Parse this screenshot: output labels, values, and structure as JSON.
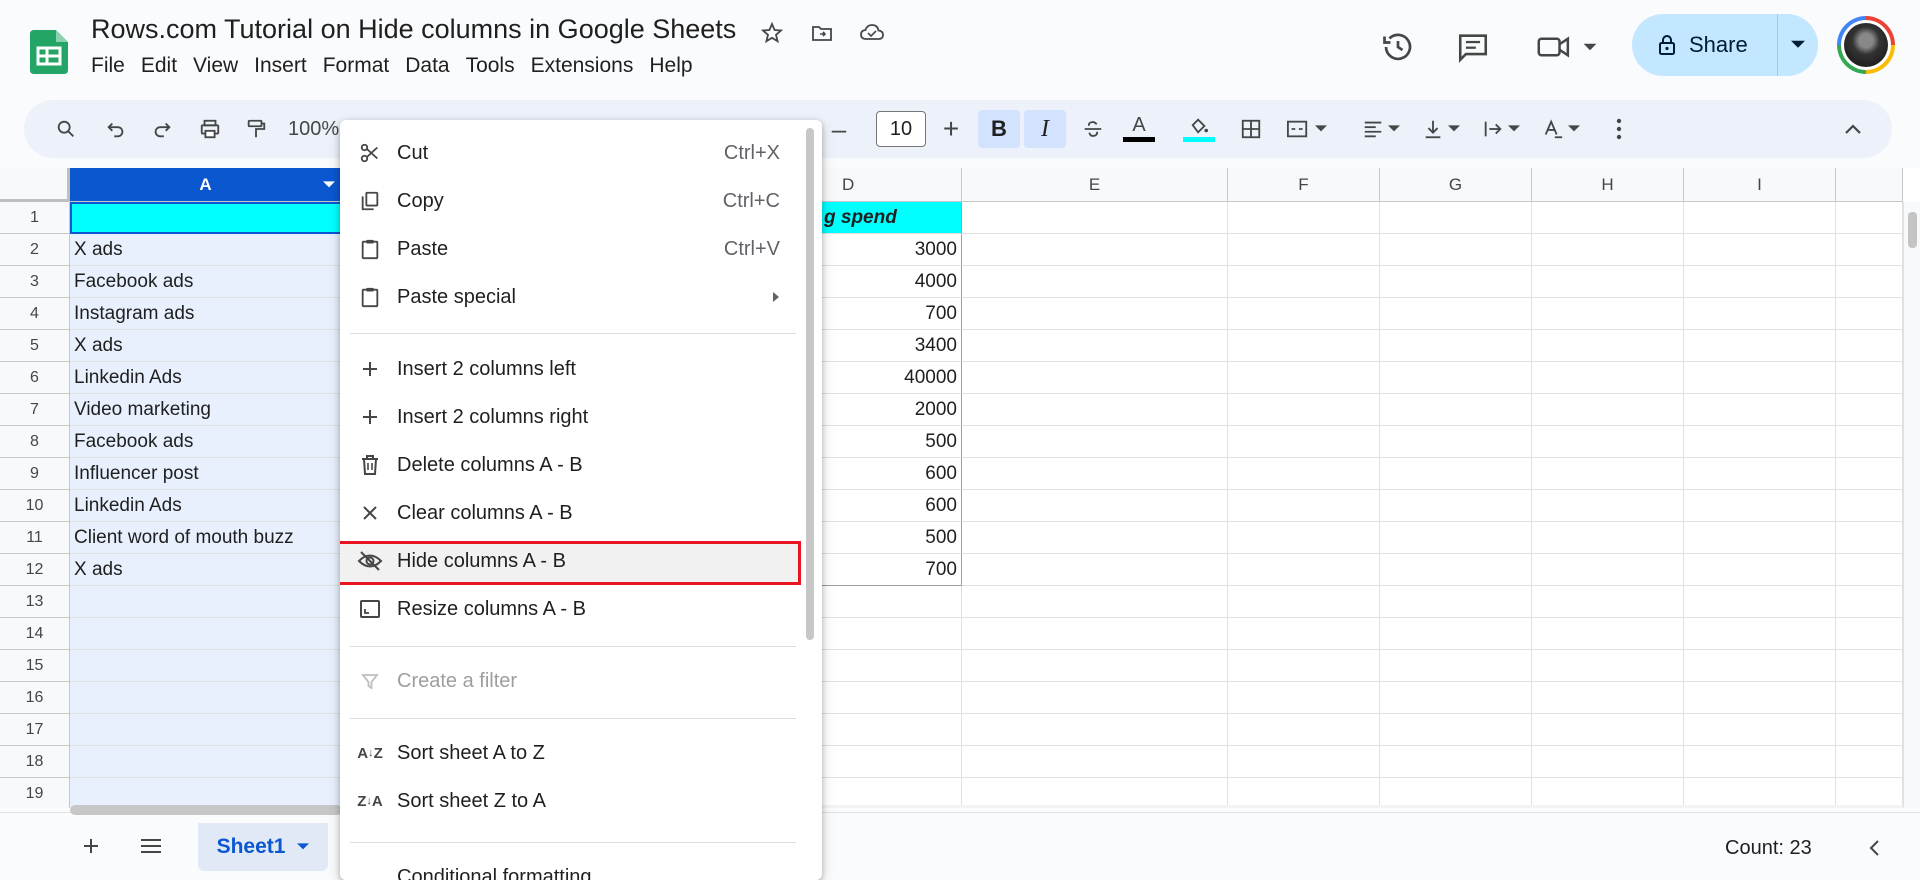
{
  "doc": {
    "title": "Rows.com Tutorial on Hide columns in Google Sheets"
  },
  "menu": [
    "File",
    "Edit",
    "View",
    "Insert",
    "Format",
    "Data",
    "Tools",
    "Extensions",
    "Help"
  ],
  "share": {
    "label": "Share"
  },
  "toolbar": {
    "zoom": "100%",
    "font_size": "10"
  },
  "columns": [
    "A",
    "D",
    "E",
    "F",
    "G",
    "H",
    "I"
  ],
  "rows": [
    "1",
    "2",
    "3",
    "4",
    "5",
    "6",
    "7",
    "8",
    "9",
    "10",
    "11",
    "12",
    "13",
    "14",
    "15",
    "16",
    "17",
    "18",
    "19"
  ],
  "col_a": [
    "",
    "X ads",
    "Facebook ads",
    "Instagram ads",
    "X ads",
    "Linkedin Ads",
    "Video marketing",
    "Facebook ads",
    "Influencer post",
    "Linkedin Ads",
    "Client word of mouth buzz",
    "X ads"
  ],
  "col_d_header": "g spend",
  "col_d": [
    "3000",
    "4000",
    "700",
    "3400",
    "40000",
    "2000",
    "500",
    "600",
    "600",
    "500",
    "700"
  ],
  "context_menu": {
    "cut": {
      "label": "Cut",
      "shortcut": "Ctrl+X"
    },
    "copy": {
      "label": "Copy",
      "shortcut": "Ctrl+C"
    },
    "paste": {
      "label": "Paste",
      "shortcut": "Ctrl+V"
    },
    "paste_special": {
      "label": "Paste special"
    },
    "insert_left": {
      "label": "Insert 2 columns left"
    },
    "insert_right": {
      "label": "Insert 2 columns right"
    },
    "delete_cols": {
      "label": "Delete columns A - B"
    },
    "clear_cols": {
      "label": "Clear columns A - B"
    },
    "hide_cols": {
      "label": "Hide columns A - B"
    },
    "resize_cols": {
      "label": "Resize columns A - B"
    },
    "create_filter": {
      "label": "Create a filter"
    },
    "sort_az": {
      "label": "Sort sheet A to Z"
    },
    "sort_za": {
      "label": "Sort sheet Z to A"
    },
    "conditional": {
      "label": "Conditional formatting"
    }
  },
  "sheet_tab": {
    "label": "Sheet1"
  },
  "status": {
    "count": "Count: 23"
  },
  "colors": {
    "selected_header": "#0b57d0",
    "header_fill": "#00ffff",
    "highlight_border": "#e8141f",
    "share_bg": "#c2e7ff"
  }
}
